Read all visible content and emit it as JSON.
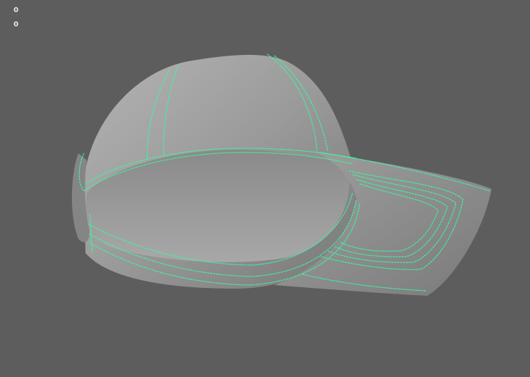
{
  "viewport": {
    "hud_values": [
      "0",
      "0"
    ],
    "wire_color": "#3cf5a0",
    "model_color": "#9a9a9a"
  }
}
